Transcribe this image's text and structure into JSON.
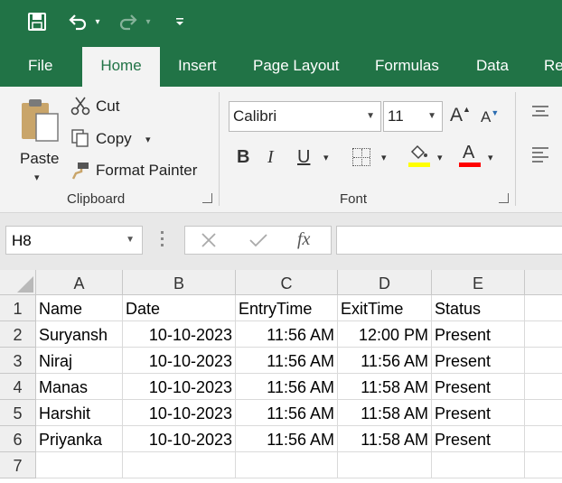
{
  "colors": {
    "brand": "#217346",
    "fill_highlight": "#ffff00",
    "font_color": "#ff0000"
  },
  "quick_access": {
    "save_icon": "save-icon",
    "undo_icon": "undo-icon",
    "redo_icon": "redo-icon",
    "customize_icon": "customize-qat-icon"
  },
  "tabs": [
    {
      "label": "File",
      "active": false
    },
    {
      "label": "Home",
      "active": true
    },
    {
      "label": "Insert",
      "active": false
    },
    {
      "label": "Page Layout",
      "active": false
    },
    {
      "label": "Formulas",
      "active": false
    },
    {
      "label": "Data",
      "active": false
    },
    {
      "label": "Re",
      "active": false
    }
  ],
  "clipboard": {
    "paste_label": "Paste",
    "cut_label": "Cut",
    "copy_label": "Copy",
    "format_painter_label": "Format Painter",
    "group_label": "Clipboard"
  },
  "font": {
    "family": "Calibri",
    "size": "11",
    "bold_label": "B",
    "italic_label": "I",
    "underline_label": "U",
    "font_color_label": "A",
    "grow_label": "A",
    "shrink_label": "A",
    "group_label": "Font"
  },
  "formula_bar": {
    "name_box": "H8",
    "fx_label": "fx",
    "formula": ""
  },
  "sheet": {
    "columns": [
      "A",
      "B",
      "C",
      "D",
      "E"
    ],
    "rows": [
      {
        "num": "1",
        "cells": [
          "Name",
          "Date",
          "EntryTime",
          "ExitTime",
          "Status"
        ]
      },
      {
        "num": "2",
        "cells": [
          "Suryansh",
          "10-10-2023",
          "11:56 AM",
          "12:00 PM",
          "Present"
        ]
      },
      {
        "num": "3",
        "cells": [
          "Niraj",
          "10-10-2023",
          "11:56 AM",
          "11:56 AM",
          "Present"
        ]
      },
      {
        "num": "4",
        "cells": [
          "Manas",
          "10-10-2023",
          "11:56 AM",
          "11:58 AM",
          "Present"
        ]
      },
      {
        "num": "5",
        "cells": [
          "Harshit",
          "10-10-2023",
          "11:56 AM",
          "11:58 AM",
          "Present"
        ]
      },
      {
        "num": "6",
        "cells": [
          "Priyanka",
          "10-10-2023",
          "11:56 AM",
          "11:58 AM",
          "Present"
        ]
      },
      {
        "num": "7",
        "cells": [
          "",
          "",
          "",
          "",
          ""
        ]
      }
    ]
  }
}
